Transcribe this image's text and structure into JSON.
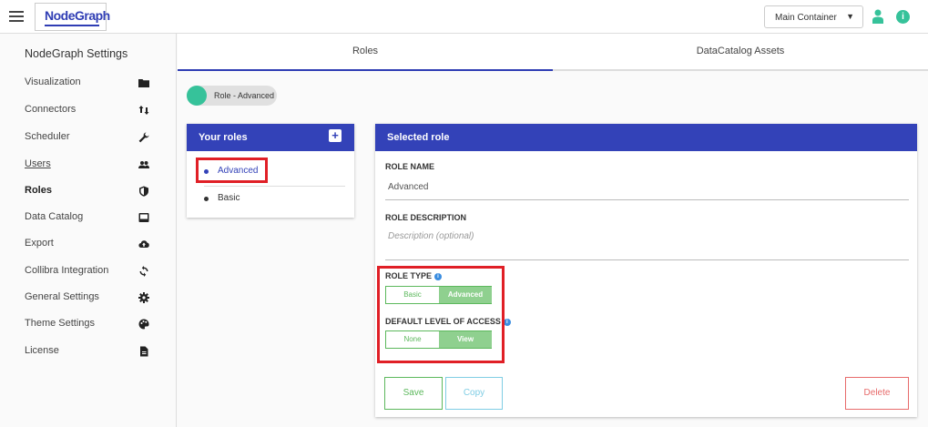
{
  "app": {
    "logo_text": "NodeGraph"
  },
  "header": {
    "container_select_value": "Main Container"
  },
  "sidebar": {
    "title": "NodeGraph Settings",
    "items": [
      {
        "label": "Visualization",
        "icon": "folder-icon"
      },
      {
        "label": "Connectors",
        "icon": "arrows-updown-icon"
      },
      {
        "label": "Scheduler",
        "icon": "wrench-icon"
      },
      {
        "label": "Users",
        "icon": "users-icon"
      },
      {
        "label": "Roles",
        "icon": "shield-icon"
      },
      {
        "label": "Data Catalog",
        "icon": "inbox-icon"
      },
      {
        "label": "Export",
        "icon": "cloud-upload-icon"
      },
      {
        "label": "Collibra Integration",
        "icon": "sync-icon"
      },
      {
        "label": "General Settings",
        "icon": "gear-icon"
      },
      {
        "label": "Theme Settings",
        "icon": "palette-icon"
      },
      {
        "label": "License",
        "icon": "document-icon"
      }
    ],
    "active": "Roles"
  },
  "tabs": [
    {
      "label": "Roles",
      "active": true
    },
    {
      "label": "DataCatalog Assets",
      "active": false
    }
  ],
  "role_chip": {
    "label": "Role - Advanced"
  },
  "your_roles": {
    "title": "Your roles",
    "roles": [
      {
        "name": "Advanced",
        "selected": true
      },
      {
        "name": "Basic",
        "selected": false
      }
    ]
  },
  "selected_role": {
    "title": "Selected role",
    "role_name_label": "ROLE NAME",
    "role_name_value": "Advanced",
    "role_description_label": "ROLE DESCRIPTION",
    "role_description_placeholder": "Description (optional)",
    "role_type_label": "ROLE TYPE",
    "role_type_options": [
      "Basic",
      "Advanced"
    ],
    "role_type_selected": "Advanced",
    "access_label": "DEFAULT LEVEL OF ACCESS",
    "access_options": [
      "None",
      "View"
    ],
    "access_selected": "View",
    "save_label": "Save",
    "copy_label": "Copy",
    "delete_label": "Delete"
  },
  "colors": {
    "primary": "#3342b8",
    "accent": "#36c29a",
    "success": "#5cb85c",
    "highlight": "#e01f26"
  }
}
